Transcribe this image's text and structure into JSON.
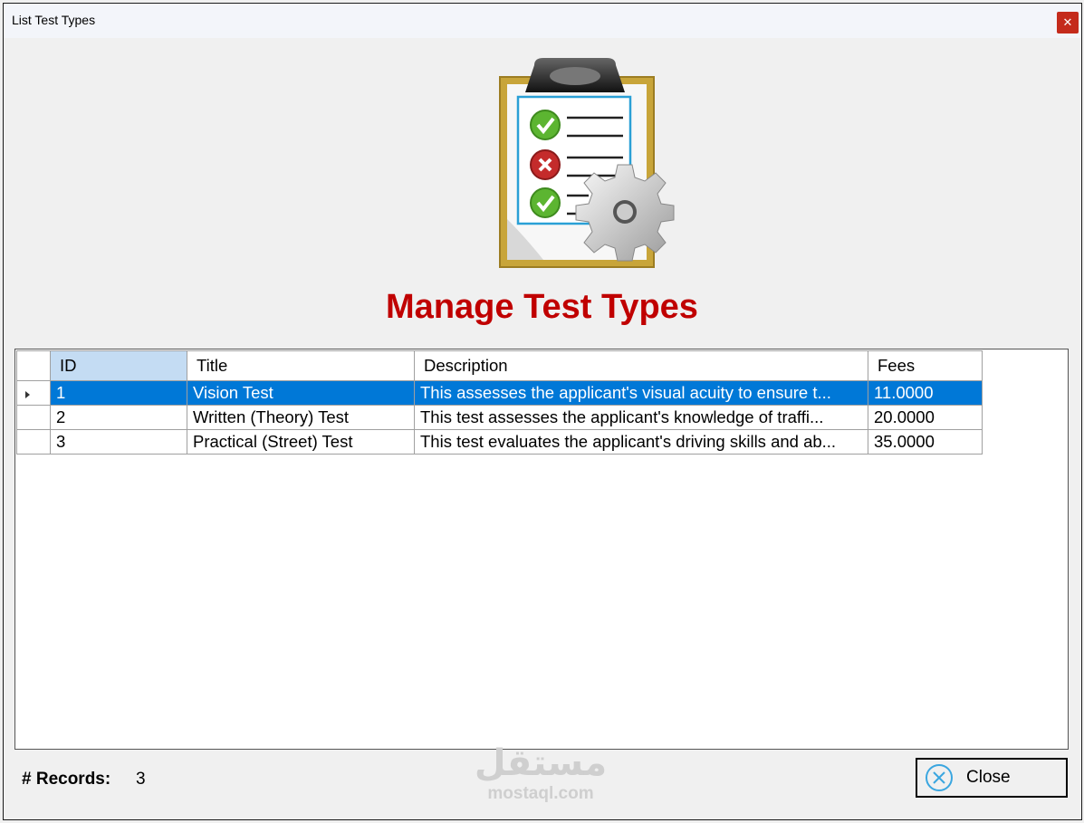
{
  "window": {
    "title": "List Test Types",
    "close_glyph": "✕"
  },
  "heading": "Manage Test Types",
  "logo_icon": "clipboard-checklist-gear-icon",
  "grid": {
    "columns": [
      "ID",
      "Title",
      "Description",
      "Fees"
    ],
    "rows": [
      {
        "id": "1",
        "title": "Vision Test",
        "description": "This assesses the applicant's visual acuity to ensure t...",
        "fees": "11.0000"
      },
      {
        "id": "2",
        "title": "Written (Theory) Test",
        "description": "This test assesses the applicant's knowledge of traffi...",
        "fees": "20.0000"
      },
      {
        "id": "3",
        "title": "Practical (Street) Test",
        "description": "This test evaluates the applicant's driving skills and ab...",
        "fees": "35.0000"
      }
    ],
    "selected_row_color": "#0078d7"
  },
  "footer": {
    "records_label": "# Records:",
    "records_value": "3",
    "close_label": "Close"
  },
  "watermark": {
    "arabic": "مستقل",
    "latin": "mostaql.com"
  }
}
